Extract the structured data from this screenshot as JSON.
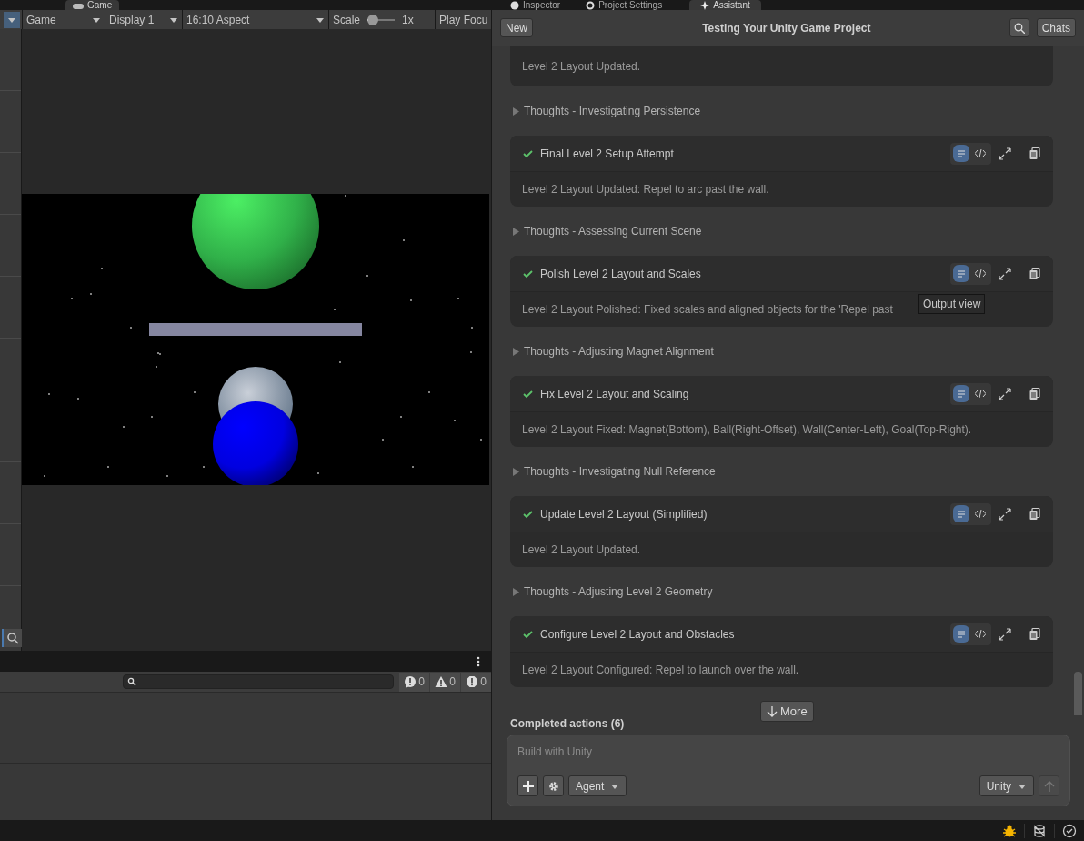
{
  "left_tabs": [
    {
      "label": "Game",
      "selected": true
    }
  ],
  "game_toolbar": {
    "items": [
      {
        "kind": "dropdown",
        "label": "Game"
      },
      {
        "kind": "dropdown",
        "label": "Display 1"
      },
      {
        "kind": "dropdown",
        "label": "16:10 Aspect"
      },
      {
        "kind": "slider",
        "label": "Scale",
        "reading": "1x",
        "level": 0
      },
      {
        "kind": "button",
        "label": "Play Focu"
      }
    ]
  },
  "console": {
    "counts": [
      {
        "kind": "log",
        "count": "0"
      },
      {
        "kind": "warning",
        "count": "0"
      },
      {
        "kind": "error",
        "count": "0"
      }
    ]
  },
  "right_tabs": [
    {
      "label": "Inspector",
      "selected": false
    },
    {
      "label": "Project Settings",
      "selected": false
    },
    {
      "label": "Assistant",
      "selected": true
    }
  ],
  "assistant": {
    "new_button": "New",
    "title": "Testing Your Unity Game Project",
    "chats_button": "Chats",
    "items": [
      {
        "kind": "fragment",
        "body": "Level 2 Layout Updated."
      },
      {
        "kind": "thoughts",
        "title": "Thoughts - Investigating Persistence"
      },
      {
        "kind": "action",
        "title": "Final Level 2 Setup Attempt",
        "body": "Level 2 Layout Updated: Repel to arc past the wall.",
        "output_view": true
      },
      {
        "kind": "thoughts",
        "title": "Thoughts - Assessing Current Scene"
      },
      {
        "kind": "action",
        "title": "Polish Level 2 Layout and Scales",
        "body": "Level 2 Layout Polished: Fixed scales and aligned objects for the 'Repel past",
        "output_view": true,
        "tooltip": "Output view"
      },
      {
        "kind": "thoughts",
        "title": "Thoughts - Adjusting Magnet Alignment"
      },
      {
        "kind": "action",
        "title": "Fix Level 2 Layout and Scaling",
        "body": "Level 2 Layout Fixed: Magnet(Bottom), Ball(Right-Offset), Wall(Center-Left), Goal(Top-Right).",
        "output_view": true
      },
      {
        "kind": "thoughts",
        "title": "Thoughts - Investigating Null Reference"
      },
      {
        "kind": "action",
        "title": "Update Level 2 Layout (Simplified)",
        "body": "Level 2 Layout Updated.",
        "output_view": true
      },
      {
        "kind": "thoughts",
        "title": "Thoughts - Adjusting Level 2 Geometry"
      },
      {
        "kind": "action",
        "title": "Configure Level 2 Layout and Obstacles",
        "body": "Level 2 Layout Configured: Repel to launch over the wall.",
        "output_view": true
      }
    ],
    "more_button": "More",
    "completed_label": "Completed actions (6)",
    "composer": {
      "placeholder": "Build with Unity",
      "mode": "Agent",
      "model": "Unity",
      "send_disabled": true
    }
  }
}
